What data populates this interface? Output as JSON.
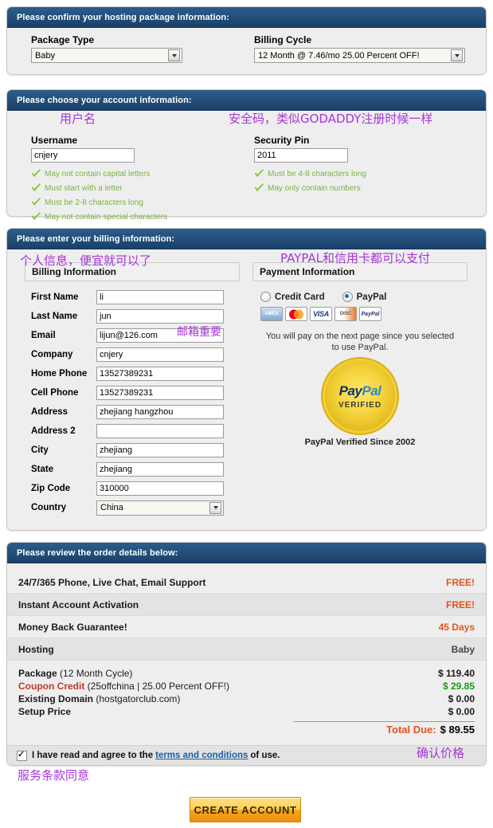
{
  "panel_package": {
    "header": "Please confirm your hosting package information:",
    "package_type_label": "Package Type",
    "package_type_value": "Baby",
    "billing_cycle_label": "Billing Cycle",
    "billing_cycle_value": "12 Month @ 7.46/mo 25.00 Percent OFF!"
  },
  "panel_account": {
    "header": "Please choose your account information:",
    "username_label": "Username",
    "username_value": "cnjery",
    "username_rules": [
      "May not contain capital letters",
      "Must start with a letter",
      "Must be 2-8 characters long",
      "May not contain special characters"
    ],
    "pin_label": "Security Pin",
    "pin_value": "2011",
    "pin_rules": [
      "Must be 4-8 characters long",
      "May only contain numbers"
    ],
    "anno_username": "用户名",
    "anno_pin": "安全码，类似GODADDY注册时候一样"
  },
  "panel_billing": {
    "header": "Please enter your billing information:",
    "billing_box_title": "Billing Information",
    "payment_box_title": "Payment Information",
    "anno_billing": "个人信息，便宜就可以了",
    "anno_payment": "PAYPAL和信用卡都可以支付",
    "anno_email": "邮箱重要",
    "fields": [
      {
        "label": "First Name",
        "value": "li",
        "type": "text"
      },
      {
        "label": "Last Name",
        "value": "jun",
        "type": "text"
      },
      {
        "label": "Email",
        "value": "lijun@126.com",
        "type": "text"
      },
      {
        "label": "Company",
        "value": "cnjery",
        "type": "text"
      },
      {
        "label": "Home Phone",
        "value": "13527389231",
        "type": "text"
      },
      {
        "label": "Cell Phone",
        "value": "13527389231",
        "type": "text"
      },
      {
        "label": "Address",
        "value": "zhejiang hangzhou",
        "type": "text"
      },
      {
        "label": "Address 2",
        "value": "",
        "type": "text"
      },
      {
        "label": "City",
        "value": "zhejiang",
        "type": "text"
      },
      {
        "label": "State",
        "value": "zhejiang",
        "type": "text"
      },
      {
        "label": "Zip Code",
        "value": "310000",
        "type": "text"
      },
      {
        "label": "Country",
        "value": "China",
        "type": "select"
      }
    ],
    "payment_options": [
      {
        "label": "Credit Card",
        "selected": false
      },
      {
        "label": "PayPal",
        "selected": true
      }
    ],
    "card_logos": [
      "american-express",
      "mastercard",
      "visa",
      "discover",
      "paypal"
    ],
    "paypal_note_line1": "You will pay on the next page since you selected",
    "paypal_note_line2": "to use PayPal.",
    "seal_brand_pay": "Pay",
    "seal_brand_pal": "Pal",
    "seal_verified": "VERIFIED",
    "seal_caption": "PayPal Verified Since 2002"
  },
  "panel_order": {
    "header": "Please review the order details below:",
    "feature_rows": [
      {
        "label": "24/7/365 Phone, Live Chat, Email Support",
        "value": "FREE!",
        "style": "free"
      },
      {
        "label": "Instant Account Activation",
        "value": "FREE!",
        "style": "free"
      },
      {
        "label": "Money Back Guarantee!",
        "value": "45 Days",
        "style": "days"
      },
      {
        "label": "Hosting",
        "value": "Baby",
        "style": "plain"
      }
    ],
    "price_rows": [
      {
        "label": "Package",
        "sub": "(12 Month Cycle)",
        "value": "$ 119.40",
        "style": "normal"
      },
      {
        "label": "Coupon Credit",
        "sub": "(25offchina | 25.00 Percent OFF!)",
        "value": "$ 29.85",
        "style": "credit"
      },
      {
        "label": "Existing Domain",
        "sub": "(hostgatorclub.com)",
        "value": "$ 0.00",
        "style": "normal"
      },
      {
        "label": "Setup Price",
        "sub": "",
        "value": "$ 0.00",
        "style": "normal"
      }
    ],
    "total_label": "Total Due:",
    "total_value": "$ 89.55",
    "terms_pre": "I have read and agree to the",
    "terms_link": "terms and conditions",
    "terms_post": "of use.",
    "anno_price": "确认价格",
    "anno_terms": "服务条款同意"
  },
  "submit": {
    "label": "CREATE ACCOUNT"
  },
  "colors": {
    "header_blue": "#24517c",
    "accent_orange": "#e2551d",
    "green_check": "#7cb342",
    "annotation_purple": "#a735d8",
    "link_blue": "#1a5fa8",
    "credit_green": "#1a9c1a"
  }
}
